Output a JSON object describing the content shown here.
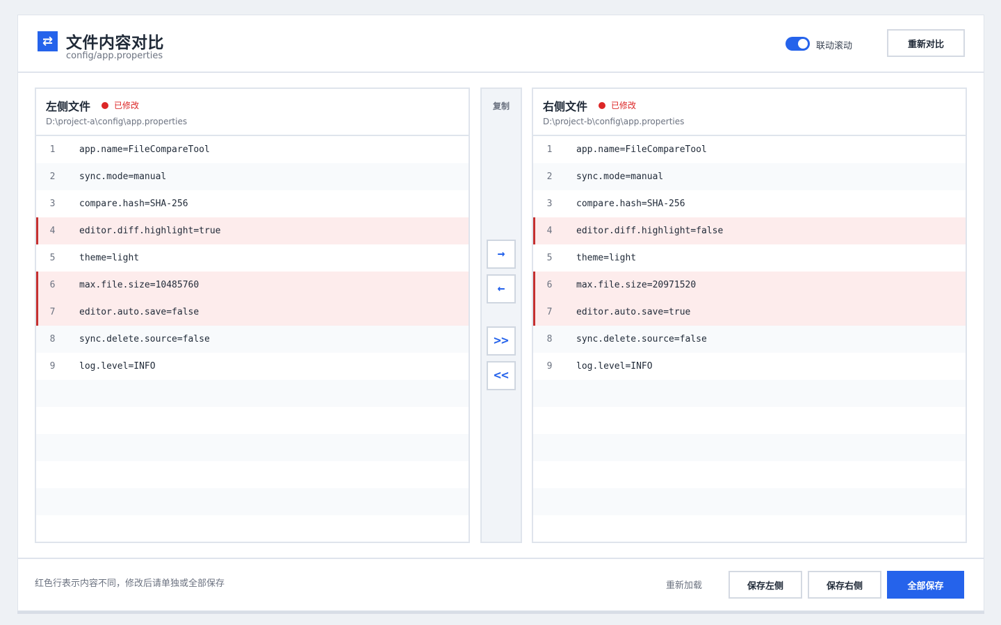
{
  "header": {
    "title": "文件内容对比",
    "subtitle": "config/app.properties",
    "app_icon": "⇄",
    "sync_scroll_label": "联动滚动",
    "sync_scroll_on": true,
    "recompare_label": "重新对比"
  },
  "left": {
    "title": "左侧文件",
    "status": "已修改",
    "path": "D:\\project-a\\config\\app.properties",
    "lines": [
      {
        "no": "1",
        "text": "app.name=FileCompareTool",
        "diff": false
      },
      {
        "no": "2",
        "text": "sync.mode=manual",
        "diff": false
      },
      {
        "no": "3",
        "text": "compare.hash=SHA-256",
        "diff": false
      },
      {
        "no": "4",
        "text": "editor.diff.highlight=true",
        "diff": true
      },
      {
        "no": "5",
        "text": "theme=light",
        "diff": false
      },
      {
        "no": "6",
        "text": "max.file.size=10485760",
        "diff": true
      },
      {
        "no": "7",
        "text": "editor.auto.save=false",
        "diff": true
      },
      {
        "no": "8",
        "text": "sync.delete.source=false",
        "diff": false
      },
      {
        "no": "9",
        "text": "log.level=INFO",
        "diff": false
      }
    ]
  },
  "right": {
    "title": "右侧文件",
    "status": "已修改",
    "path": "D:\\project-b\\config\\app.properties",
    "lines": [
      {
        "no": "1",
        "text": "app.name=FileCompareTool",
        "diff": false
      },
      {
        "no": "2",
        "text": "sync.mode=manual",
        "diff": false
      },
      {
        "no": "3",
        "text": "compare.hash=SHA-256",
        "diff": false
      },
      {
        "no": "4",
        "text": "editor.diff.highlight=false",
        "diff": true
      },
      {
        "no": "5",
        "text": "theme=light",
        "diff": false
      },
      {
        "no": "6",
        "text": "max.file.size=20971520",
        "diff": true
      },
      {
        "no": "7",
        "text": "editor.auto.save=true",
        "diff": true
      },
      {
        "no": "8",
        "text": "sync.delete.source=false",
        "diff": false
      },
      {
        "no": "9",
        "text": "log.level=INFO",
        "diff": false
      }
    ]
  },
  "middle": {
    "label": "复制",
    "copy_right": "→",
    "copy_left": "←",
    "copy_all_right": ">>",
    "copy_all_left": "<<"
  },
  "footer": {
    "note": "红色行表示内容不同，修改后请单独或全部保存",
    "reload_label": "重新加载",
    "save_left_label": "保存左侧",
    "save_right_label": "保存右侧",
    "save_all_label": "全部保存"
  },
  "colors": {
    "accent": "#2563eb",
    "diff_bg": "#fdecec",
    "diff_marker": "#c53030",
    "modified": "#dc2626"
  }
}
